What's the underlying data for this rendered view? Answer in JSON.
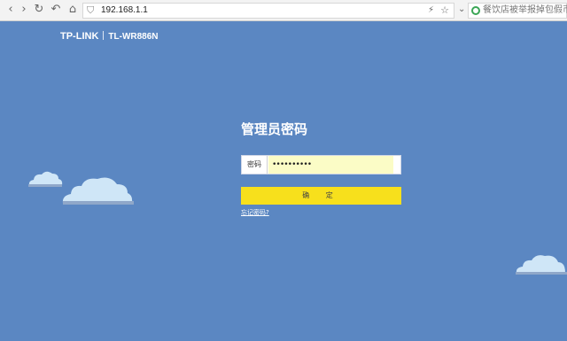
{
  "browser": {
    "address": "192.168.1.1",
    "search_placeholder": "餐饮店被举报掉包假币",
    "icons": [
      "back-icon",
      "forward-icon",
      "reload-icon",
      "undo-icon",
      "home-icon",
      "shield-icon",
      "bolt-icon",
      "star-icon",
      "chevron-down-icon",
      "search-engine-icon"
    ]
  },
  "brand": {
    "logo": "TP-LINK",
    "model": "TL-WR886N"
  },
  "login": {
    "title": "管理员密码",
    "password_label": "密码",
    "password_value": "••••••••••",
    "confirm_label": "确 定",
    "forgot_link": "忘记密码?"
  },
  "colors": {
    "background": "#5b87c2",
    "confirm_button": "#f7e01c",
    "input_autofill": "#fbfcc6",
    "cloud": "#cfe6f7"
  }
}
